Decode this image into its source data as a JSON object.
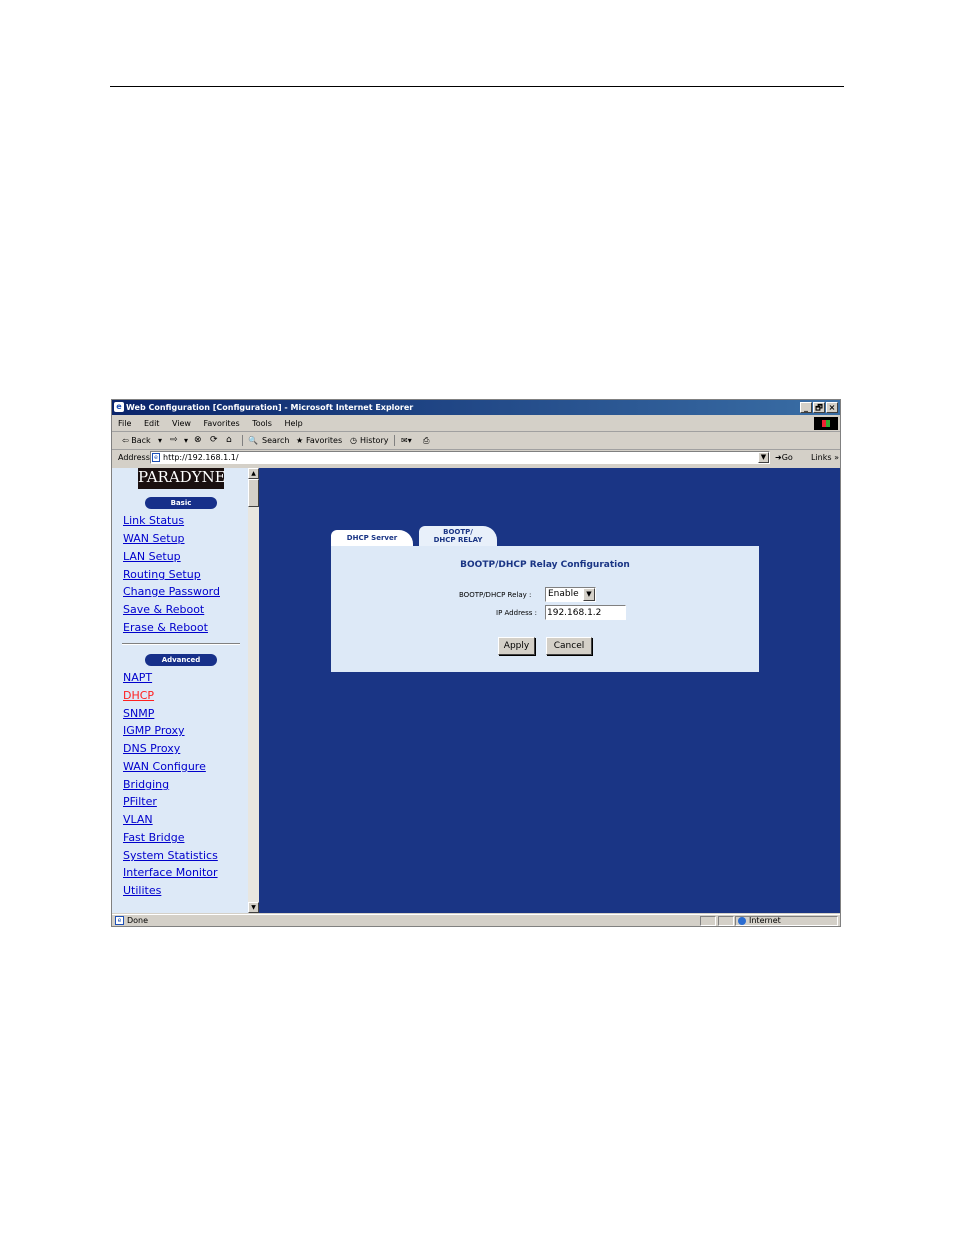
{
  "window": {
    "title": "Web Configuration [Configuration] - Microsoft Internet Explorer",
    "buttons": {
      "minimize": "_",
      "restore": "🗗",
      "close": "×"
    }
  },
  "menu": {
    "items": [
      "File",
      "Edit",
      "View",
      "Favorites",
      "Tools",
      "Help"
    ]
  },
  "toolbar": {
    "back": "⇦ Back",
    "back_drop": "▾",
    "forward": "⇨",
    "forward_drop": "▾",
    "stop": "⊗",
    "refresh": "⟳",
    "home": "⌂",
    "search": "Search",
    "favorites": "Favorites",
    "history": "History",
    "mail": "✉▾",
    "print": "⎙"
  },
  "address": {
    "label": "Address",
    "value": "http://192.168.1.1/",
    "go": "Go",
    "links": "Links »"
  },
  "sidebar": {
    "logo": "PARADYNE",
    "basic_label": "Basic",
    "basic_items": [
      "Link Status",
      "WAN Setup",
      "LAN Setup",
      "Routing Setup",
      "Change Password",
      "Save & Reboot",
      "Erase & Reboot"
    ],
    "advanced_label": "Advanced",
    "advanced_items": [
      "NAPT",
      "DHCP",
      "SNMP",
      "IGMP Proxy",
      "DNS Proxy",
      "WAN Configure",
      "Bridging",
      "PFilter",
      "VLAN",
      "Fast Bridge",
      "System Statistics",
      "Interface Monitor",
      "Utilites"
    ]
  },
  "tabs": {
    "dhcp_server": "DHCP Server",
    "relay_line1": "BOOTP/",
    "relay_line2": "DHCP RELAY"
  },
  "form": {
    "title": "BOOTP/DHCP Relay Configuration",
    "relay_label": "BOOTP/DHCP Relay :",
    "relay_value": "Enable",
    "ip_label": "IP Address :",
    "ip_value": "192.168.1.2",
    "apply": "Apply",
    "cancel": "Cancel"
  },
  "status": {
    "text": "Done",
    "zone": "Internet"
  },
  "colors": {
    "content_bg": "#1a3585",
    "sidebar_bg": "#dde9f7",
    "title_bar": "#0a246a",
    "link": "#0000cc",
    "active_link": "#ff2020"
  }
}
